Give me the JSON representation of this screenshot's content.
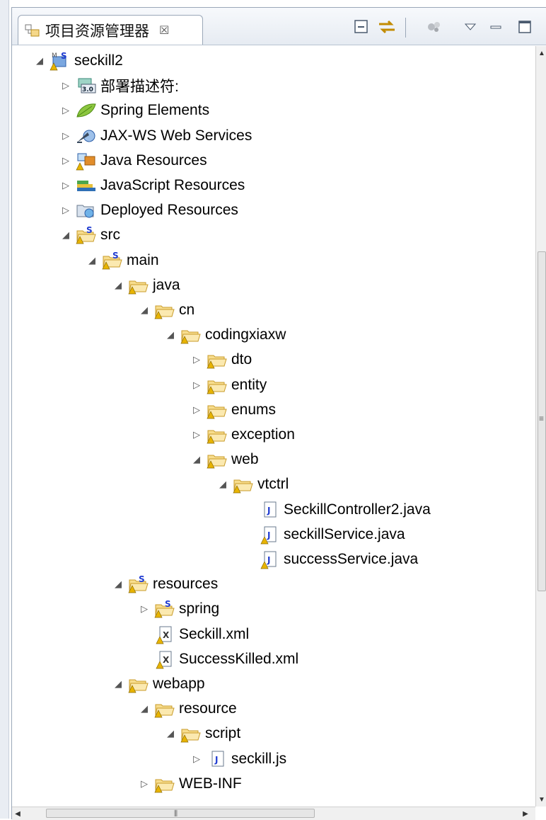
{
  "view": {
    "title": "项目资源管理器",
    "close_glyph": "☒",
    "toolbar": {
      "collapse_icon": "collapse-all-icon",
      "link_icon": "link-with-editor-icon",
      "filters_icon": "filters-icon",
      "menu_icon": "view-menu-icon",
      "minimize_icon": "minimize-icon",
      "maximize_icon": "maximize-icon"
    }
  },
  "tree": [
    {
      "label": "seckill2",
      "level": 0,
      "state": "expanded",
      "icon": "web-project-icon"
    },
    {
      "label": "部署描述符:",
      "level": 1,
      "state": "collapsed",
      "icon": "deployment-descriptor-icon"
    },
    {
      "label": "Spring Elements",
      "level": 1,
      "state": "collapsed",
      "icon": "spring-leaf-icon"
    },
    {
      "label": "JAX-WS Web Services",
      "level": 1,
      "state": "collapsed",
      "icon": "web-services-icon"
    },
    {
      "label": "Java Resources",
      "level": 1,
      "state": "collapsed",
      "icon": "java-resources-icon"
    },
    {
      "label": "JavaScript Resources",
      "level": 1,
      "state": "collapsed",
      "icon": "javascript-resources-icon"
    },
    {
      "label": "Deployed Resources",
      "level": 1,
      "state": "collapsed",
      "icon": "deployed-resources-icon"
    },
    {
      "label": "src",
      "level": 1,
      "state": "expanded",
      "icon": "spring-folder-icon"
    },
    {
      "label": "main",
      "level": 2,
      "state": "expanded",
      "icon": "spring-folder-icon"
    },
    {
      "label": "java",
      "level": 3,
      "state": "expanded",
      "icon": "folder-icon"
    },
    {
      "label": "cn",
      "level": 4,
      "state": "expanded",
      "icon": "folder-icon"
    },
    {
      "label": "codingxiaxw",
      "level": 5,
      "state": "expanded",
      "icon": "folder-icon"
    },
    {
      "label": "dto",
      "level": 6,
      "state": "collapsed",
      "icon": "folder-icon"
    },
    {
      "label": "entity",
      "level": 6,
      "state": "collapsed",
      "icon": "folder-icon"
    },
    {
      "label": "enums",
      "level": 6,
      "state": "collapsed",
      "icon": "folder-icon"
    },
    {
      "label": "exception",
      "level": 6,
      "state": "collapsed",
      "icon": "folder-icon"
    },
    {
      "label": "web",
      "level": 6,
      "state": "expanded",
      "icon": "folder-icon"
    },
    {
      "label": "vtctrl",
      "level": 7,
      "state": "expanded",
      "icon": "folder-icon"
    },
    {
      "label": "SeckillController2.java",
      "level": 8,
      "state": "leaf",
      "icon": "java-file-icon"
    },
    {
      "label": "seckillService.java",
      "level": 8,
      "state": "leaf",
      "icon": "java-file-warning-icon"
    },
    {
      "label": "successService.java",
      "level": 8,
      "state": "leaf",
      "icon": "java-file-warning-icon"
    },
    {
      "label": "resources",
      "level": 3,
      "state": "expanded",
      "icon": "spring-folder-icon"
    },
    {
      "label": "spring",
      "level": 4,
      "state": "collapsed",
      "icon": "spring-folder-icon"
    },
    {
      "label": "Seckill.xml",
      "level": 4,
      "state": "leaf",
      "icon": "xml-file-icon"
    },
    {
      "label": "SuccessKilled.xml",
      "level": 4,
      "state": "leaf",
      "icon": "xml-file-icon"
    },
    {
      "label": "webapp",
      "level": 3,
      "state": "expanded",
      "icon": "folder-icon"
    },
    {
      "label": "resource",
      "level": 4,
      "state": "expanded",
      "icon": "folder-icon"
    },
    {
      "label": "script",
      "level": 5,
      "state": "expanded",
      "icon": "folder-icon"
    },
    {
      "label": "seckill.js",
      "level": 6,
      "state": "collapsed",
      "icon": "js-file-icon"
    },
    {
      "label": "WEB-INF",
      "level": 4,
      "state": "collapsed",
      "icon": "folder-icon"
    }
  ],
  "colors": {
    "selection": "#3399ff",
    "folder": "#f2c94c",
    "spring_s": "#1f3bd1",
    "warning": "#e0a100"
  }
}
